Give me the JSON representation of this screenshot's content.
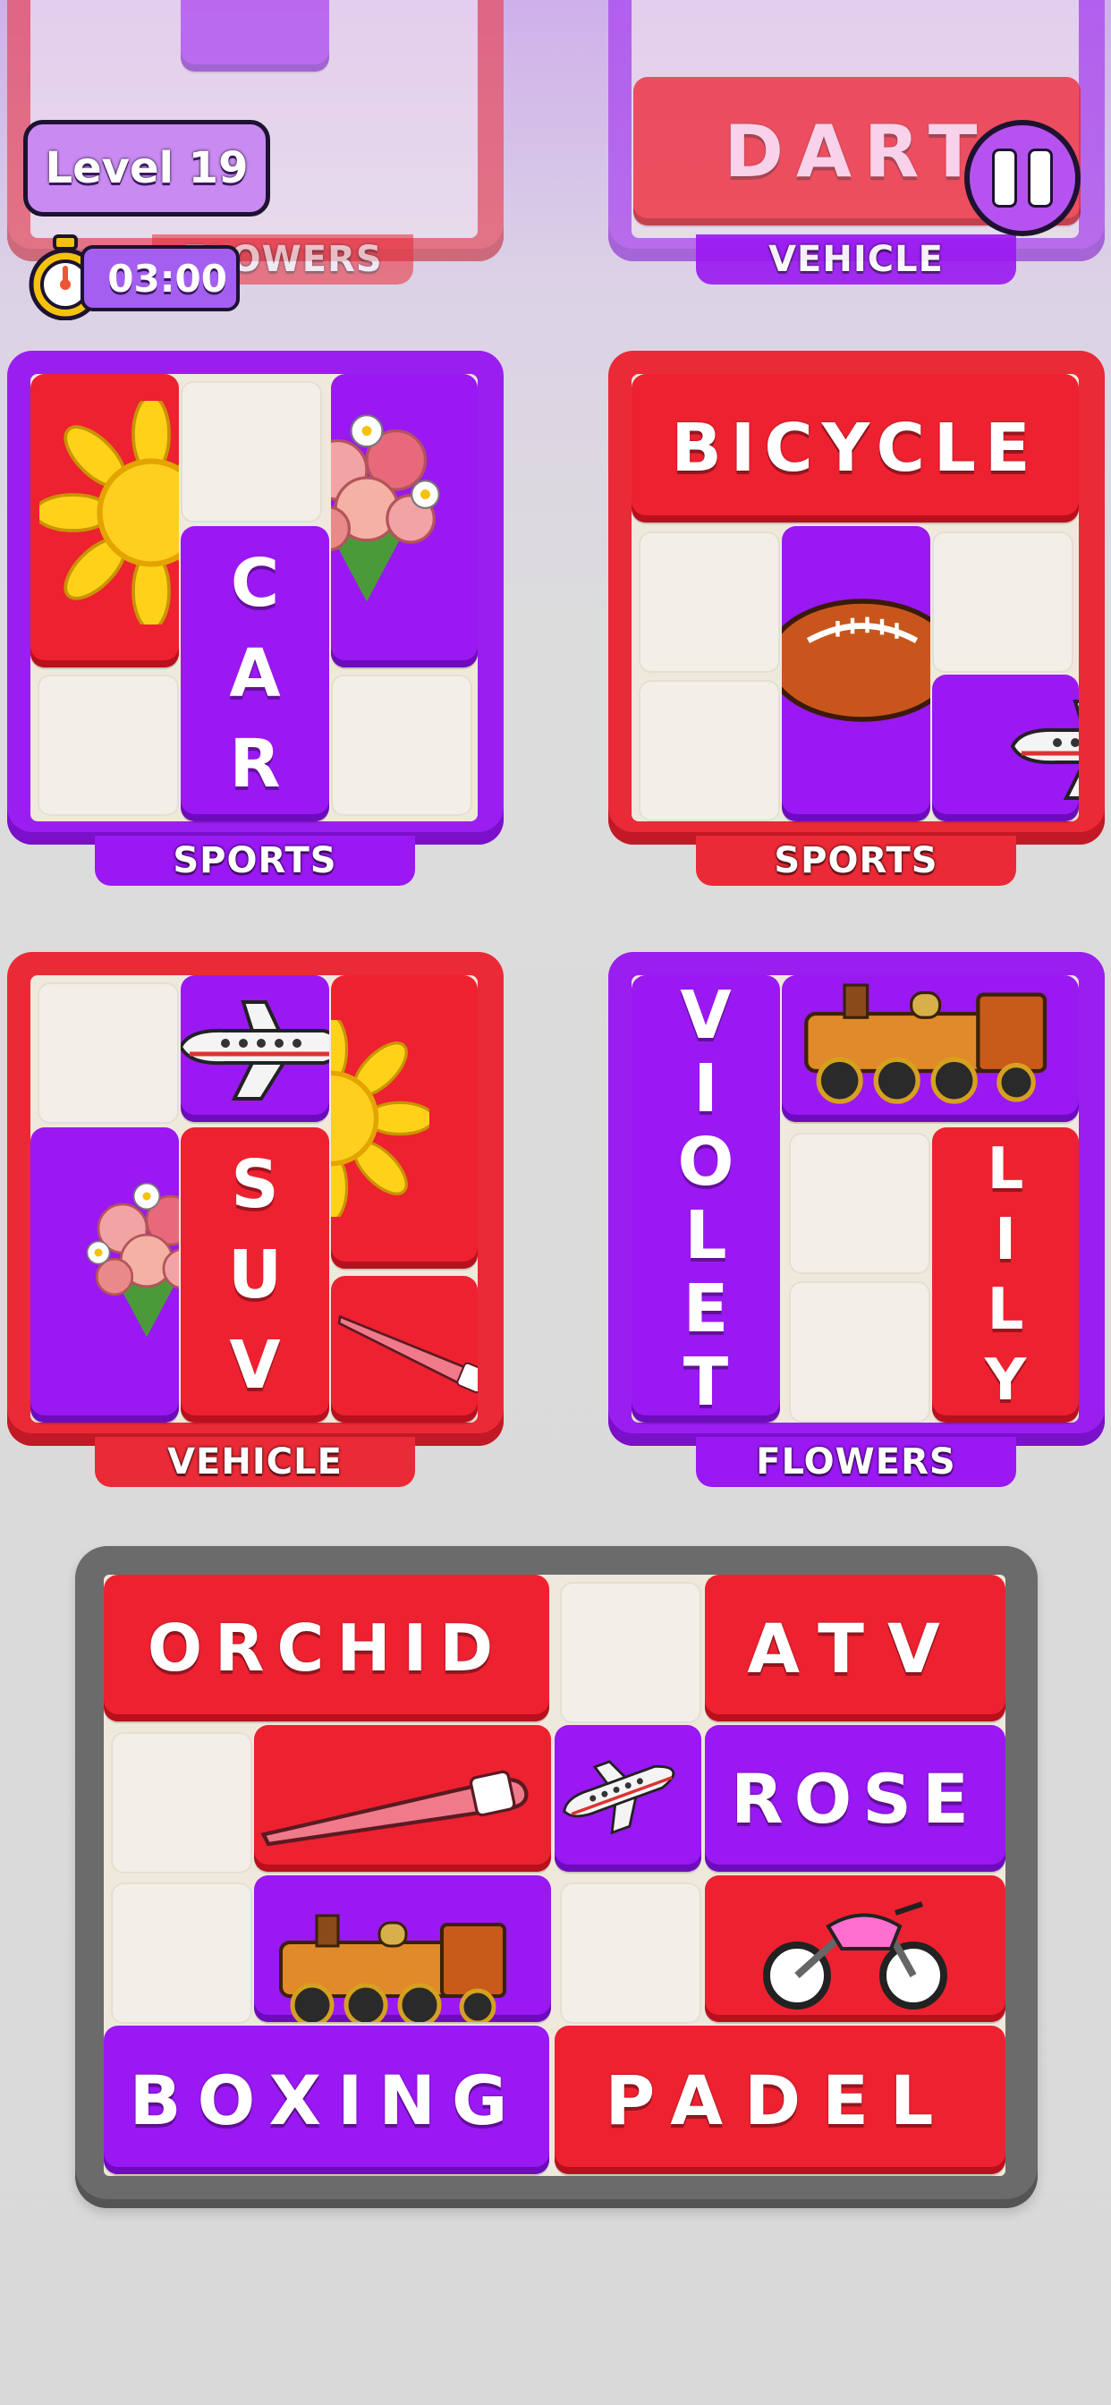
{
  "hud": {
    "level_label": "Level 19",
    "timer": "03:00"
  },
  "boards": {
    "top_left_label": "FLOWERS",
    "top_right_word": "DART",
    "top_right_label": "VEHICLE",
    "b1": {
      "word_letters": [
        "C",
        "A",
        "R"
      ],
      "label": "SPORTS"
    },
    "b2": {
      "word": "BICYCLE",
      "label": "SPORTS"
    },
    "b3": {
      "word_letters": [
        "S",
        "U",
        "V"
      ],
      "label": "VEHICLE"
    },
    "b4": {
      "word1_letters": [
        "V",
        "I",
        "O",
        "L",
        "E",
        "T"
      ],
      "word2_letters": [
        "L",
        "I",
        "L",
        "Y"
      ],
      "label": "FLOWERS"
    }
  },
  "tray": {
    "orchid": "ORCHID",
    "atv": "ATV",
    "rose": "ROSE",
    "boxing": "BOXING",
    "padel": "PADEL"
  },
  "icons": [
    "sunflower-icon",
    "bouquet-icon",
    "football-icon",
    "airplane-icon",
    "train-icon",
    "hockey-stick-icon",
    "motorcycle-icon",
    "stopwatch-icon",
    "pause-icon"
  ],
  "colors": {
    "purple": "#9a18f2",
    "red": "#ee2130",
    "cream": "#efe9dc",
    "tray": "#6b6b6b"
  }
}
